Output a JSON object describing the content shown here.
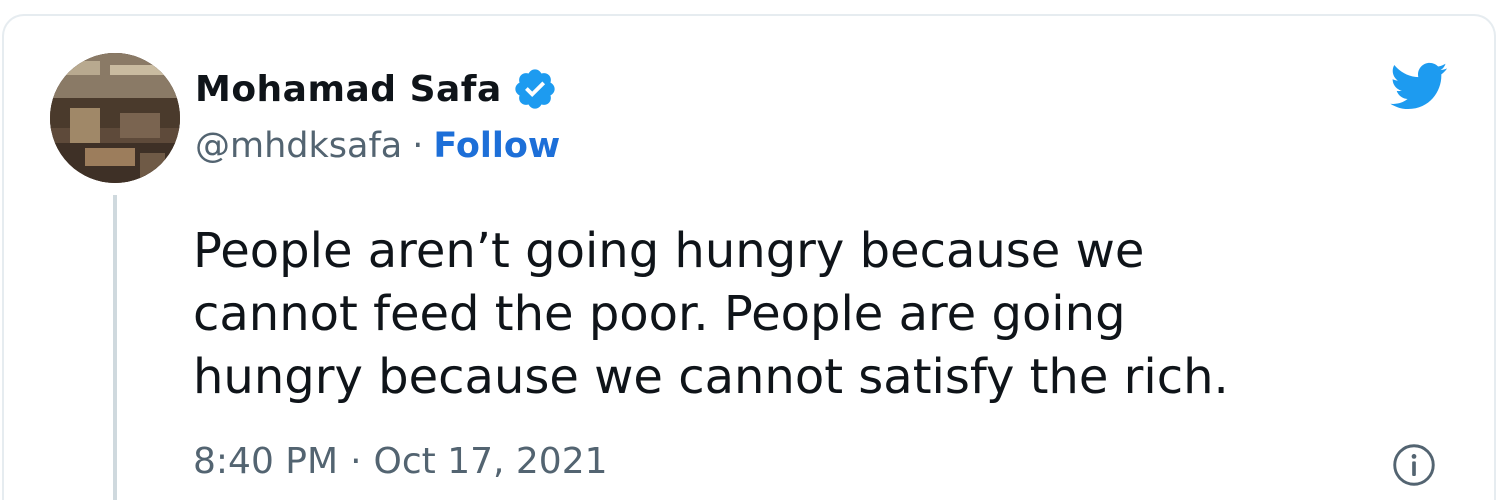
{
  "author": {
    "display_name": "Mohamad Safa",
    "handle": "@mhdksafa",
    "separator": "·",
    "follow_label": "Follow",
    "verified": true
  },
  "tweet": {
    "text_lines": [
      "People aren’t going hungry because we",
      "cannot feed the poor. People are going",
      "hungry because we cannot satisfy the rich."
    ]
  },
  "meta": {
    "time": "8:40 PM",
    "separator": "·",
    "date": "Oct 17, 2021"
  },
  "icons": {
    "brand": "twitter-bird-icon",
    "verified": "verified-badge-icon",
    "info": "info-icon"
  },
  "colors": {
    "brand_blue": "#1d9bf0",
    "link_blue": "#1d6fd8",
    "text_primary": "#0f1419",
    "text_secondary": "#536471",
    "border": "#e6ecf0"
  }
}
